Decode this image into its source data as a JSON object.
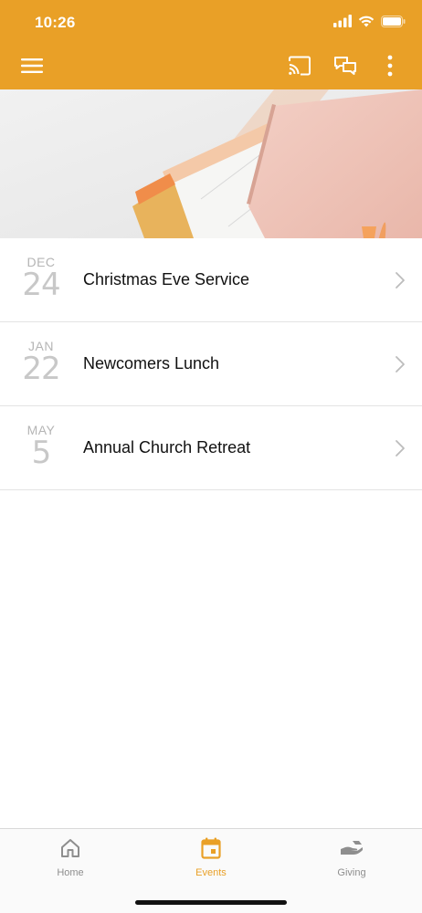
{
  "status_bar": {
    "time": "10:26",
    "icons": [
      "signal-icon",
      "wifi-icon",
      "battery-icon"
    ]
  },
  "app_bar": {
    "background": "#E9A027",
    "icons": [
      "menu-icon",
      "cast-icon",
      "chat-icon",
      "more-vertical-icon"
    ]
  },
  "hero": {
    "image": "notebook-desk-photo"
  },
  "events": [
    {
      "month": "DEC",
      "day": "24",
      "title": "Christmas Eve Service"
    },
    {
      "month": "JAN",
      "day": "22",
      "title": "Newcomers Lunch"
    },
    {
      "month": "MAY",
      "day": "5",
      "title": "Annual Church Retreat"
    }
  ],
  "tabs": [
    {
      "label": "Home",
      "icon": "home-icon",
      "active": false
    },
    {
      "label": "Events",
      "icon": "calendar-icon",
      "active": true
    },
    {
      "label": "Giving",
      "icon": "giving-hand-icon",
      "active": false
    }
  ],
  "colors": {
    "accent": "#E9A027",
    "inactive_tab": "#8e8e8e"
  }
}
